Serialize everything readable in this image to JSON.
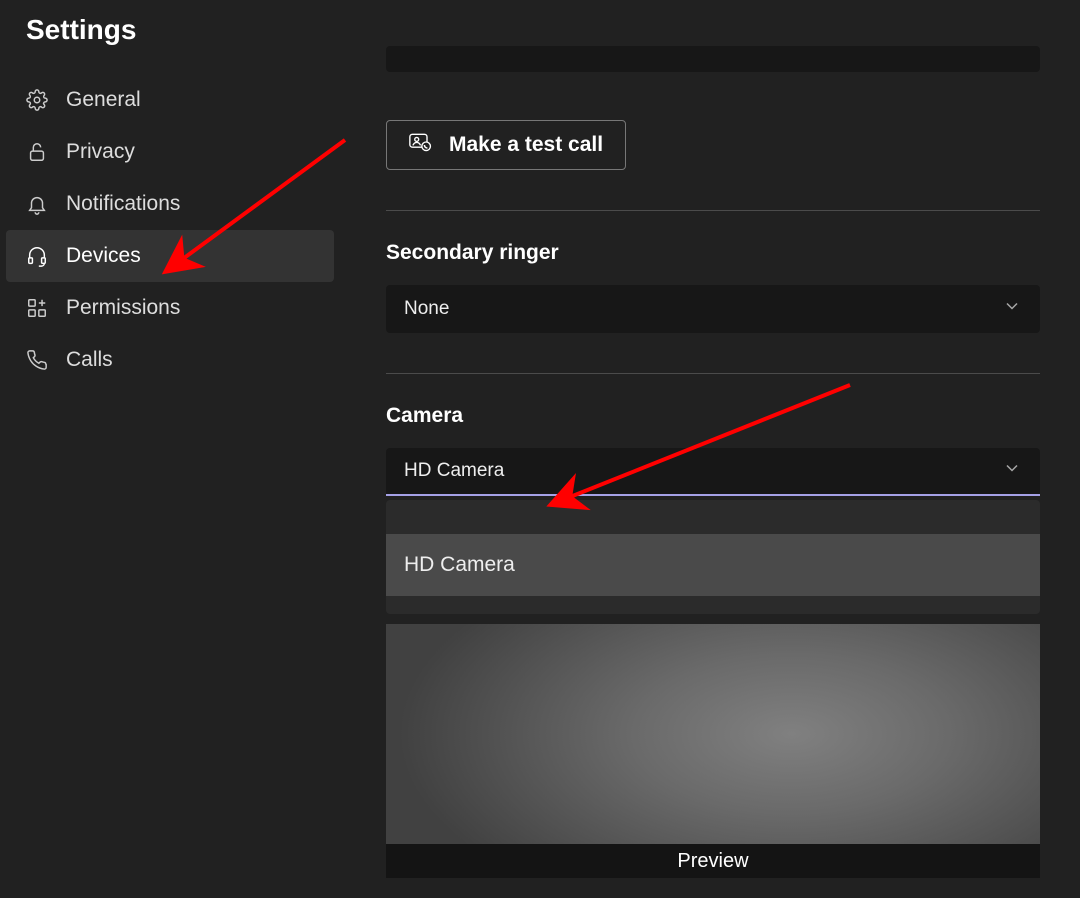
{
  "title": "Settings",
  "sidebar": {
    "items": [
      {
        "label": "General",
        "icon": "gear-icon",
        "active": false
      },
      {
        "label": "Privacy",
        "icon": "lock-icon",
        "active": false
      },
      {
        "label": "Notifications",
        "icon": "bell-icon",
        "active": false
      },
      {
        "label": "Devices",
        "icon": "headset-icon",
        "active": true
      },
      {
        "label": "Permissions",
        "icon": "apps-icon",
        "active": false
      },
      {
        "label": "Calls",
        "icon": "phone-icon",
        "active": false
      }
    ]
  },
  "main": {
    "test_call_label": "Make a test call",
    "secondary_ringer": {
      "label": "Secondary ringer",
      "value": "None"
    },
    "camera": {
      "label": "Camera",
      "value": "HD Camera",
      "options": [
        "HD Camera"
      ],
      "preview_label": "Preview"
    }
  }
}
